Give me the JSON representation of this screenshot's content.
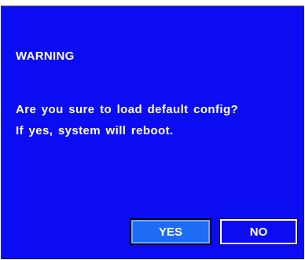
{
  "dialog": {
    "title": "WARNING",
    "message_line1": "Are you sure to load default config?",
    "message_line2": "If yes, system will reboot.",
    "yes_label": "YES",
    "no_label": "NO",
    "selected_button": "YES"
  },
  "colors": {
    "dialog_background": "#0c0cf2",
    "selected_button": "#1e6cf6",
    "text": "#ffffff"
  }
}
